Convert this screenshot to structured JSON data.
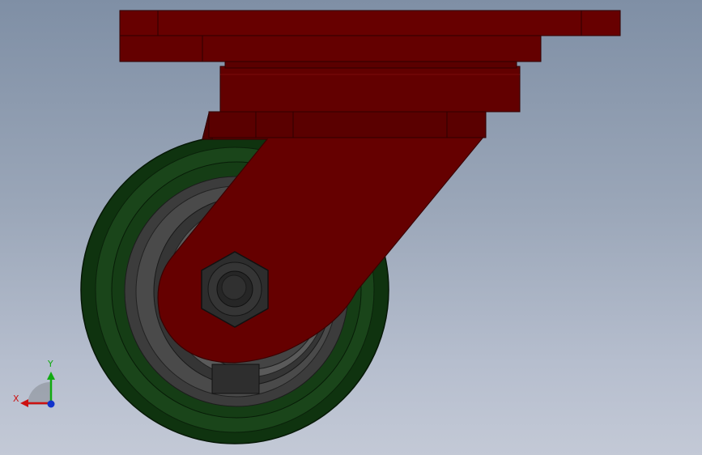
{
  "view": {
    "model_colors": {
      "frame_red": "#650000",
      "frame_red_dark": "#4a0000",
      "tire_green": "#123b12",
      "hub_gray": "#3a3a3a",
      "nut_gray": "#2b2b2b"
    }
  },
  "triad": {
    "x_label": "X",
    "y_label": "Y",
    "x_color": "#cc1111",
    "y_color": "#11aa11",
    "z_color": "#1133cc"
  }
}
